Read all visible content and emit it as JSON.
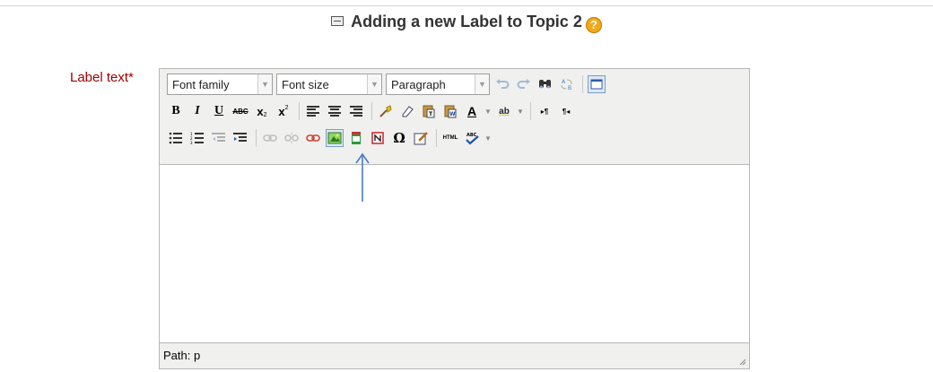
{
  "page": {
    "heading": "Adding a new Label to Topic 2",
    "help_glyph": "?"
  },
  "form": {
    "label_text": "Label text",
    "required_mark": "*"
  },
  "editor": {
    "font_family": "Font family",
    "font_size": "Font size",
    "format": "Paragraph",
    "path_label": "Path: p",
    "content": ""
  },
  "toolbar_icons": {
    "row1": [
      "undo-icon",
      "redo-icon",
      "find-icon",
      "replace-icon",
      "fullscreen-icon"
    ],
    "row2": [
      "bold-icon",
      "italic-icon",
      "underline-icon",
      "strikethrough-icon",
      "subscript-icon",
      "superscript-icon",
      "align-left-icon",
      "align-center-icon",
      "align-right-icon",
      "cleanup-icon",
      "eraser-icon",
      "paste-text-icon",
      "paste-word-icon",
      "text-color-icon",
      "highlight-color-icon",
      "ltr-icon",
      "rtl-icon"
    ],
    "row3": [
      "bullet-list-icon",
      "numbered-list-icon",
      "outdent-icon",
      "indent-icon",
      "link-icon",
      "unlink-icon",
      "anchor-icon",
      "insert-image-icon",
      "media-icon",
      "nonbreaking-icon",
      "special-char-icon",
      "edit-icon",
      "html-icon",
      "spellcheck-icon"
    ]
  },
  "annotation": {
    "arrow_color": "#4a7cc4",
    "points_to": "insert-image-icon"
  },
  "colors": {
    "required_label": "#a00000",
    "toolbar_bg": "#f0f0ee",
    "border": "#b8b8b8"
  }
}
